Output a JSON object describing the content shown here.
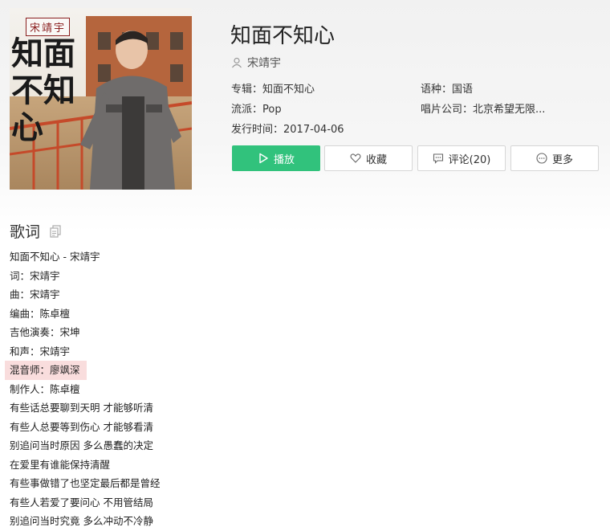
{
  "song": {
    "title": "知面不知心",
    "artist": "宋靖宇",
    "cover_text_artist": "宋靖宇",
    "cover_text_title": "知面不知心"
  },
  "meta": {
    "album": "专辑：知面不知心",
    "language": "语种：国语",
    "genre": "流派：Pop",
    "label": "唱片公司：北京希望无限...",
    "release": "发行时间：2017-04-06"
  },
  "actions": {
    "play": "播放",
    "favorite": "收藏",
    "comments": "评论(20)",
    "more": "更多"
  },
  "lyrics": {
    "heading": "歌词",
    "highlight_index": 6,
    "lines": [
      "知面不知心 - 宋靖宇",
      "词：宋靖宇",
      "曲：宋靖宇",
      "编曲：陈卓檀",
      "吉他演奏：宋坤",
      "和声：宋靖宇",
      "混音师：廖飒深",
      "制作人：陈卓檀",
      "有些话总要聊到天明 才能够听清",
      "有些人总要等到伤心 才能够看清",
      "别追问当时原因 多么愚蠢的决定",
      "在爱里有谁能保持清醒",
      "有些事做错了也坚定最后都是曾经",
      "有些人若爱了要问心 不用管结局",
      "别追问当时究竟 多么冲动不冷静"
    ]
  },
  "colors": {
    "accent": "#31c27c",
    "highlight": "#f9dddd"
  }
}
